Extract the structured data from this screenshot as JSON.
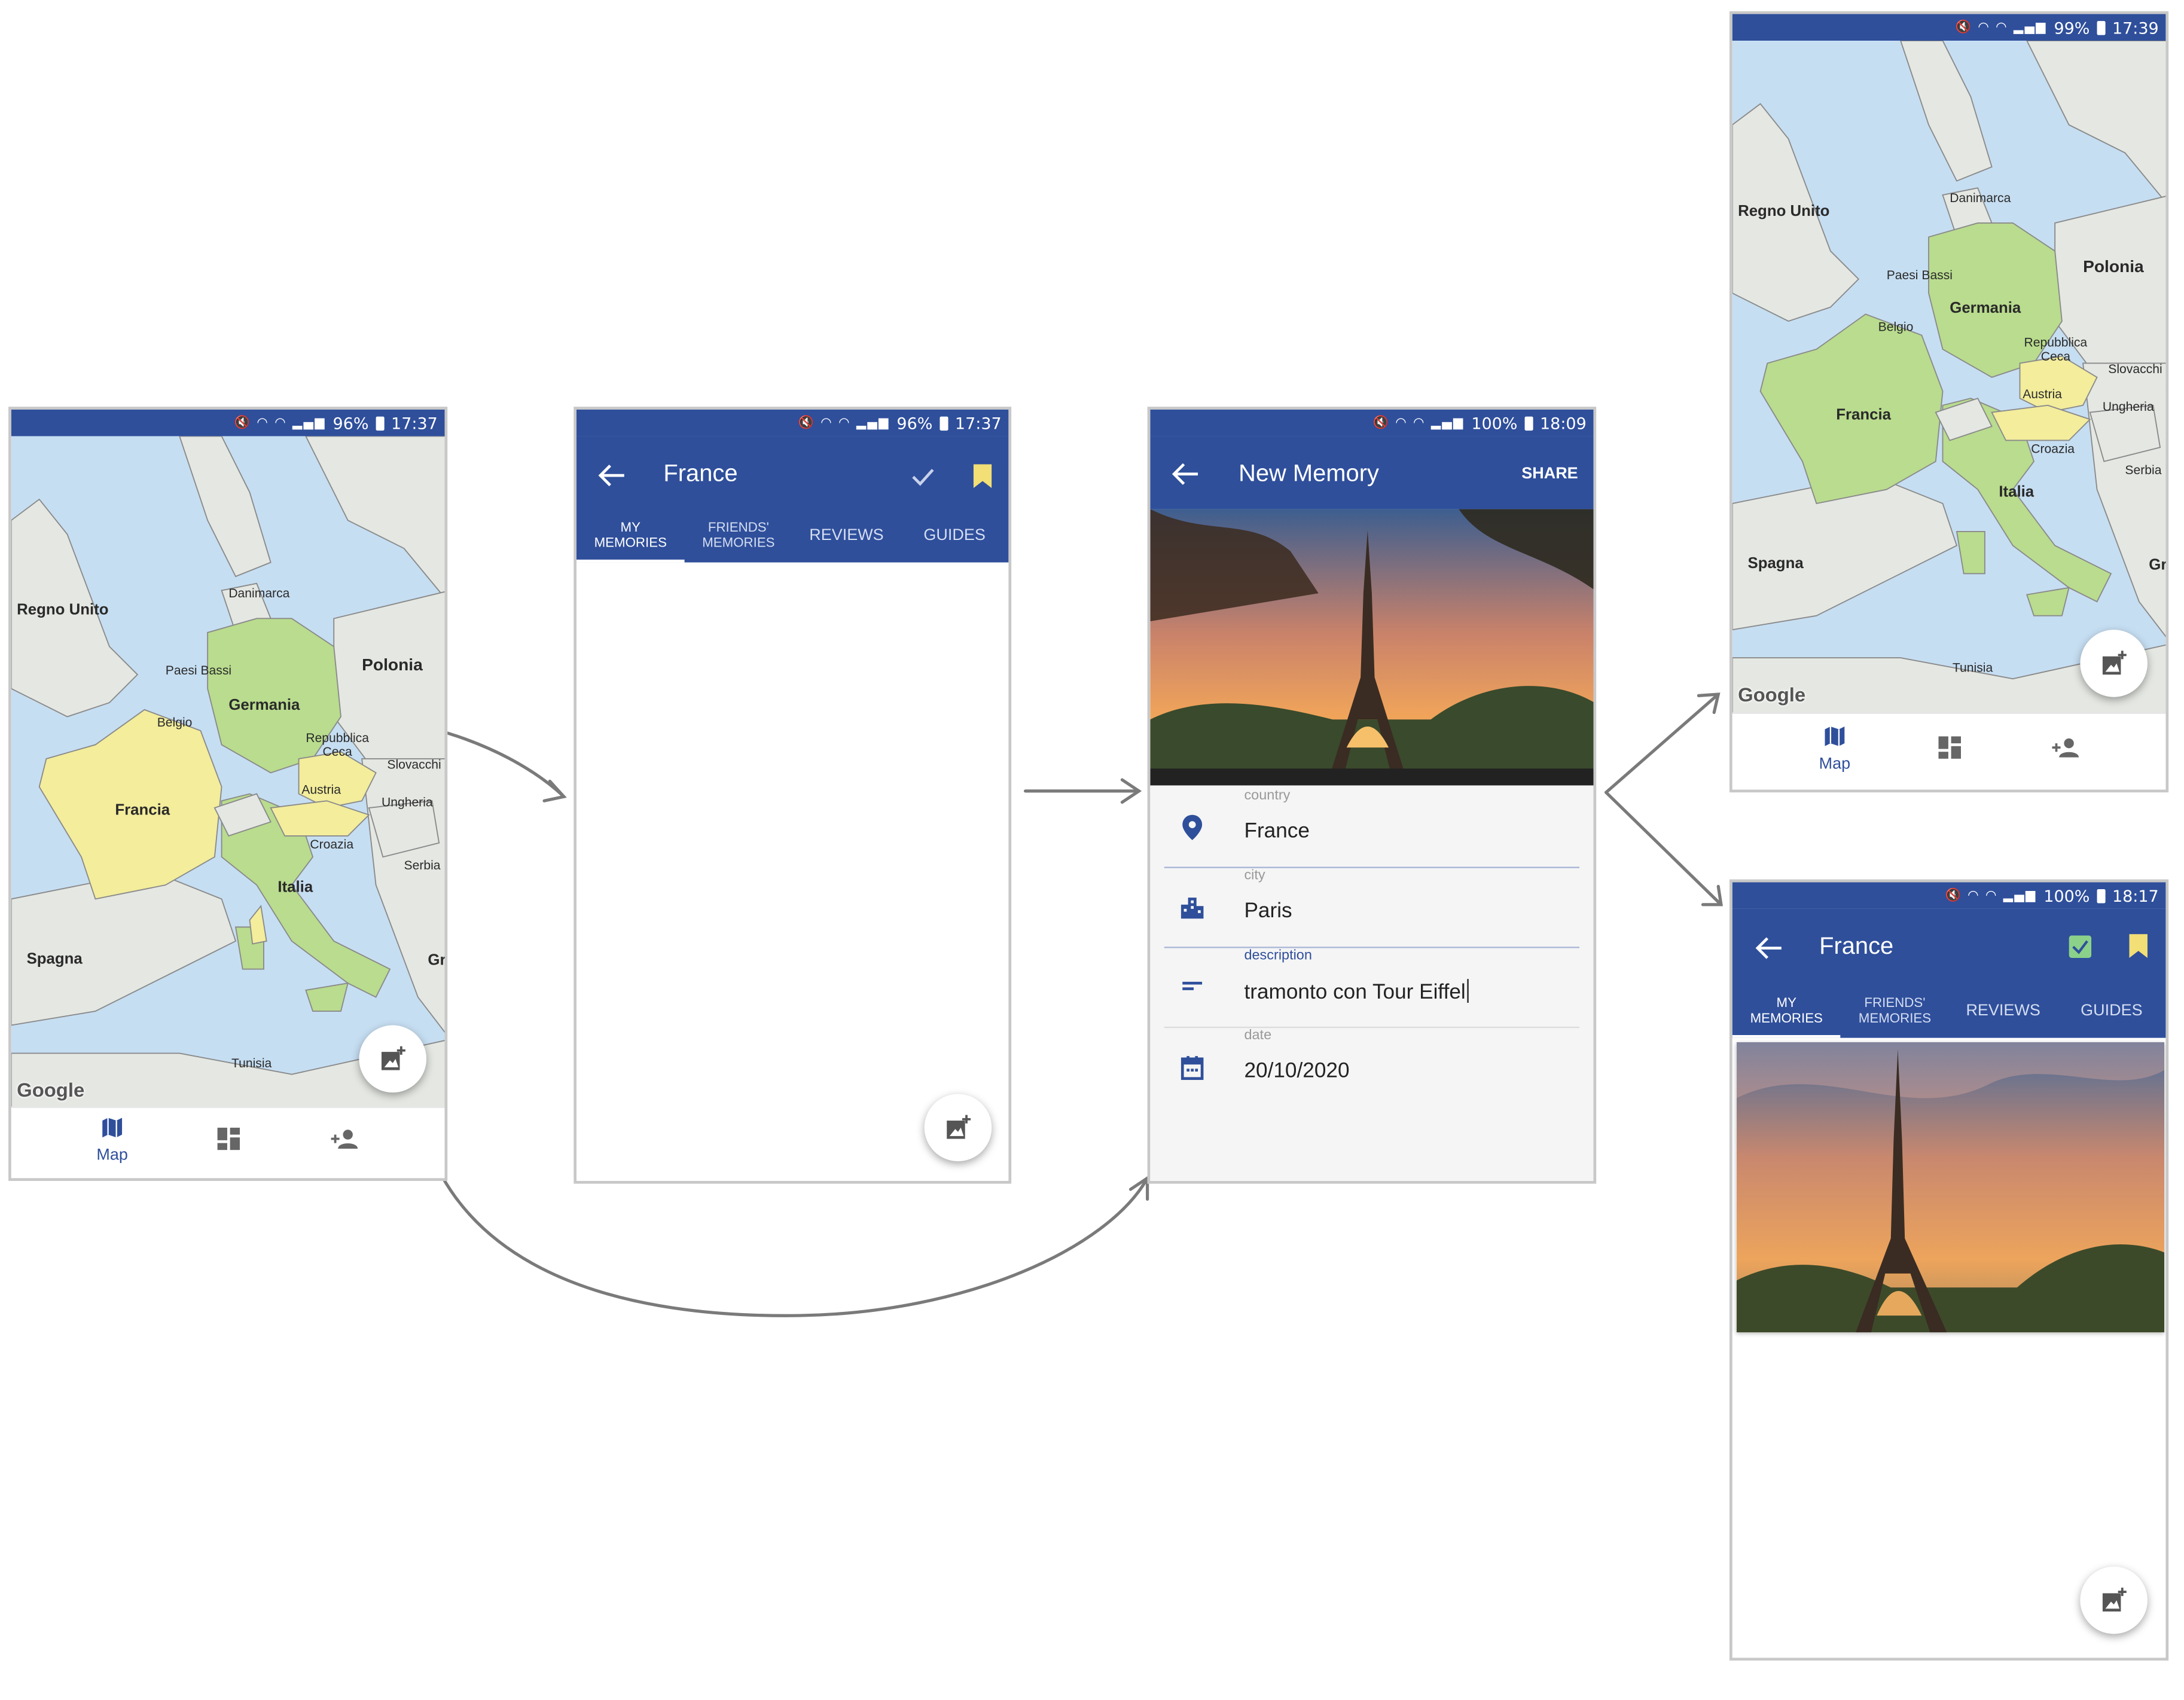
{
  "screens": {
    "map_start": {
      "status": {
        "battery": "96%",
        "time": "17:37"
      },
      "labels": {
        "regno_unito": "Regno Unito",
        "danimarca": "Danimarca",
        "paesi_bassi": "Paesi Bassi",
        "germania": "Germania",
        "polonia": "Polonia",
        "belgio": "Belgio",
        "repubblica_ceca": "Repubblica\nCeca",
        "slovacchia": "Slovacchi",
        "francia": "Francia",
        "austria": "Austria",
        "ungheria": "Ungheria",
        "croazia": "Croazia",
        "serbia": "Serbia",
        "italia": "Italia",
        "spagna": "Spagna",
        "gr": "Gr",
        "tunisia": "Tunisia"
      },
      "google": "Google",
      "nav": {
        "map_label": "Map"
      }
    },
    "france_empty": {
      "status": {
        "battery": "96%",
        "time": "17:37"
      },
      "title": "France",
      "tabs": [
        "MY\nMEMORIES",
        "FRIENDS'\nMEMORIES",
        "REVIEWS",
        "GUIDES"
      ]
    },
    "new_memory": {
      "status": {
        "battery": "100%",
        "time": "18:09"
      },
      "title": "New Memory",
      "share": "SHARE",
      "fields": {
        "country": {
          "label": "country",
          "value": "France"
        },
        "city": {
          "label": "city",
          "value": "Paris"
        },
        "description": {
          "label": "description",
          "value": "tramonto con Tour Eiffel"
        },
        "date": {
          "label": "date",
          "value": "20/10/2020"
        }
      }
    },
    "map_updated": {
      "status": {
        "battery": "99%",
        "time": "17:39"
      },
      "labels": {
        "regno_unito": "Regno Unito",
        "danimarca": "Danimarca",
        "paesi_bassi": "Paesi Bassi",
        "germania": "Germania",
        "polonia": "Polonia",
        "belgio": "Belgio",
        "repubblica_ceca": "Repubblica\nCeca",
        "slovacchia": "Slovacchi",
        "francia": "Francia",
        "austria": "Austria",
        "ungheria": "Ungheria",
        "croazia": "Croazia",
        "serbia": "Serbia",
        "italia": "Italia",
        "spagna": "Spagna",
        "gr": "Gr",
        "tunisia": "Tunisia"
      },
      "google": "Google",
      "nav": {
        "map_label": "Map"
      }
    },
    "france_memory": {
      "status": {
        "battery": "100%",
        "time": "18:17"
      },
      "title": "France",
      "tabs": [
        "MY\nMEMORIES",
        "FRIENDS'\nMEMORIES",
        "REVIEWS",
        "GUIDES"
      ]
    }
  },
  "colors": {
    "primary": "#2f4f9b",
    "sea": "#c6def2",
    "land": "#e4e7e2",
    "visited": "#b9dc8e",
    "wishlist": "#f3ed9c",
    "bookmark": "#f2df75",
    "checked": "#8bd18a"
  }
}
